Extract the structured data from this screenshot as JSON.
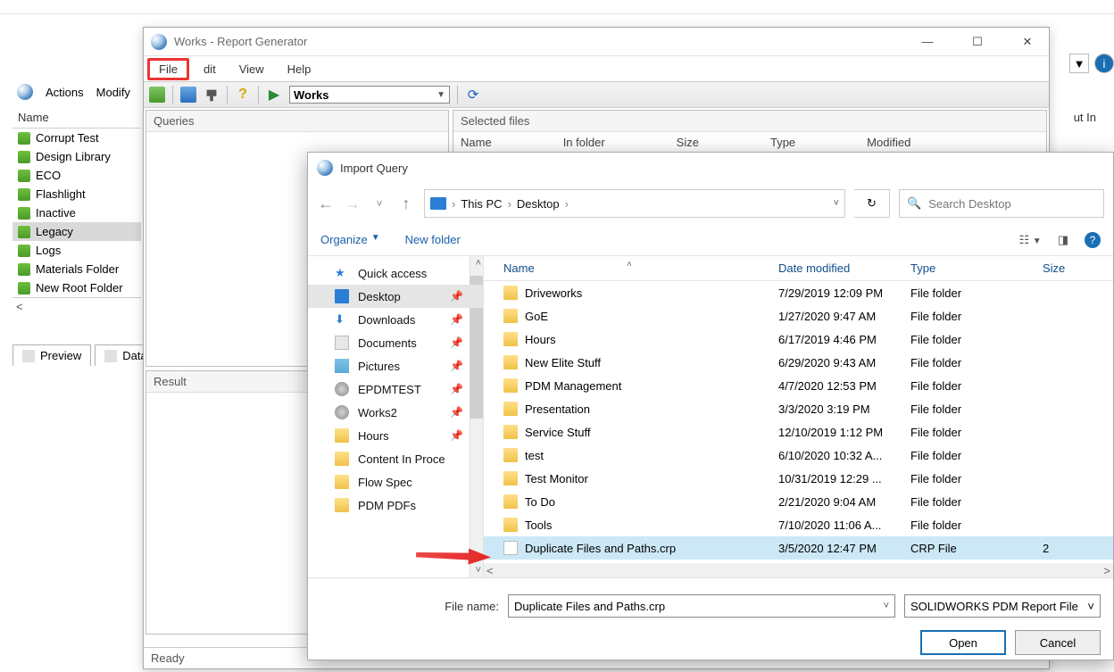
{
  "bg": {
    "toolbar": {
      "actions": "Actions",
      "modify": "Modify"
    },
    "sidebar_header": "Name",
    "items": [
      {
        "label": "Corrupt Test",
        "sel": false
      },
      {
        "label": "Design Library",
        "sel": false
      },
      {
        "label": "ECO",
        "sel": false
      },
      {
        "label": "Flashlight",
        "sel": false
      },
      {
        "label": "Inactive",
        "sel": false
      },
      {
        "label": "Legacy",
        "sel": true
      },
      {
        "label": "Logs",
        "sel": false
      },
      {
        "label": "Materials Folder",
        "sel": false
      },
      {
        "label": "New Root Folder",
        "sel": false
      }
    ],
    "tabs": {
      "preview": "Preview",
      "data": "Data"
    },
    "put_in": "ut In"
  },
  "rg": {
    "title": "Works - Report Generator",
    "menu": {
      "file": "File",
      "edit": "dit",
      "view": "View",
      "help": "Help"
    },
    "combo": "Works",
    "panes": {
      "queries": "Queries",
      "selected": "Selected files"
    },
    "cols": {
      "name": "Name",
      "infolder": "In folder",
      "size": "Size",
      "type": "Type",
      "modified": "Modified"
    },
    "result": "Result",
    "status": "Ready"
  },
  "fd": {
    "title": "Import Query",
    "crumbs": [
      "This PC",
      "Desktop"
    ],
    "search_placeholder": "Search Desktop",
    "tools": {
      "organize": "Organize",
      "newfolder": "New folder"
    },
    "side": [
      {
        "label": "Quick access",
        "icon": "star",
        "pin": false,
        "sel": false
      },
      {
        "label": "Desktop",
        "icon": "monitor",
        "pin": true,
        "sel": true
      },
      {
        "label": "Downloads",
        "icon": "dl",
        "pin": true,
        "sel": false
      },
      {
        "label": "Documents",
        "icon": "doc",
        "pin": true,
        "sel": false
      },
      {
        "label": "Pictures",
        "icon": "pic",
        "pin": true,
        "sel": false
      },
      {
        "label": "EPDMTEST",
        "icon": "pdm",
        "pin": true,
        "sel": false
      },
      {
        "label": "Works2",
        "icon": "pdm",
        "pin": true,
        "sel": false
      },
      {
        "label": "Hours",
        "icon": "fold",
        "pin": true,
        "sel": false
      },
      {
        "label": "Content In Proce",
        "icon": "fold",
        "pin": false,
        "sel": false
      },
      {
        "label": "Flow Spec",
        "icon": "fold",
        "pin": false,
        "sel": false
      },
      {
        "label": "PDM PDFs",
        "icon": "fold",
        "pin": false,
        "sel": false
      }
    ],
    "cols": {
      "name": "Name",
      "date": "Date modified",
      "type": "Type",
      "size": "Size"
    },
    "rows": [
      {
        "name": "Driveworks",
        "date": "7/29/2019 12:09 PM",
        "type": "File folder",
        "icon": "fold",
        "sel": false,
        "size": ""
      },
      {
        "name": "GoE",
        "date": "1/27/2020 9:47 AM",
        "type": "File folder",
        "icon": "fold",
        "sel": false,
        "size": ""
      },
      {
        "name": "Hours",
        "date": "6/17/2019 4:46 PM",
        "type": "File folder",
        "icon": "fold",
        "sel": false,
        "size": ""
      },
      {
        "name": "New Elite Stuff",
        "date": "6/29/2020 9:43 AM",
        "type": "File folder",
        "icon": "fold",
        "sel": false,
        "size": ""
      },
      {
        "name": "PDM Management",
        "date": "4/7/2020 12:53 PM",
        "type": "File folder",
        "icon": "fold",
        "sel": false,
        "size": ""
      },
      {
        "name": "Presentation",
        "date": "3/3/2020 3:19 PM",
        "type": "File folder",
        "icon": "fold",
        "sel": false,
        "size": ""
      },
      {
        "name": "Service Stuff",
        "date": "12/10/2019 1:12 PM",
        "type": "File folder",
        "icon": "fold",
        "sel": false,
        "size": ""
      },
      {
        "name": "test",
        "date": "6/10/2020 10:32 A...",
        "type": "File folder",
        "icon": "fold",
        "sel": false,
        "size": ""
      },
      {
        "name": "Test Monitor",
        "date": "10/31/2019 12:29 ...",
        "type": "File folder",
        "icon": "fold",
        "sel": false,
        "size": ""
      },
      {
        "name": "To Do",
        "date": "2/21/2020 9:04 AM",
        "type": "File folder",
        "icon": "fold",
        "sel": false,
        "size": ""
      },
      {
        "name": "Tools",
        "date": "7/10/2020 11:06 A...",
        "type": "File folder",
        "icon": "fold",
        "sel": false,
        "size": ""
      },
      {
        "name": "Duplicate Files and Paths.crp",
        "date": "3/5/2020 12:47 PM",
        "type": "CRP File",
        "icon": "file",
        "sel": true,
        "size": "2 "
      }
    ],
    "foot": {
      "label": "File name:",
      "value": "Duplicate Files and Paths.crp",
      "filter": "SOLIDWORKS PDM Report File",
      "open": "Open",
      "cancel": "Cancel"
    }
  }
}
